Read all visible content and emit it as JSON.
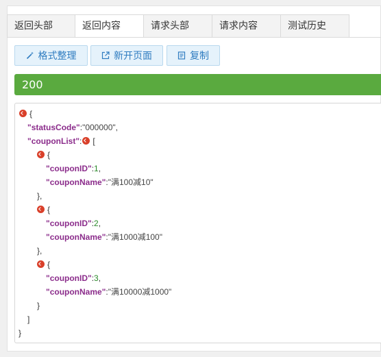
{
  "tabs": [
    {
      "label": "返回头部",
      "active": false
    },
    {
      "label": "返回内容",
      "active": true
    },
    {
      "label": "请求头部",
      "active": false
    },
    {
      "label": "请求内容",
      "active": false
    },
    {
      "label": "测试历史",
      "active": false
    }
  ],
  "toolbar": {
    "format_label": "格式整理",
    "newpage_label": "新开页面",
    "copy_label": "复制"
  },
  "status": {
    "code": "200",
    "color": "#5aaa3f"
  },
  "json": {
    "statusCode_key": "\"statusCode\"",
    "statusCode_val": "\"000000\"",
    "couponList_key": "\"couponList\"",
    "couponID_key": "\"couponID\"",
    "couponName_key": "\"couponName\"",
    "coupons": [
      {
        "id": "1",
        "name": "\"满100减10\""
      },
      {
        "id": "2",
        "name": "\"满1000减100\""
      },
      {
        "id": "3",
        "name": "\"满10000减1000\""
      }
    ]
  },
  "colors": {
    "tab_bg": "#f3f3f3",
    "button_bg": "#e5f2fb",
    "button_text": "#2f7cc0",
    "json_key": "#8b2c8b",
    "json_number": "#2a8a2a",
    "toggle": "#d9402a"
  }
}
